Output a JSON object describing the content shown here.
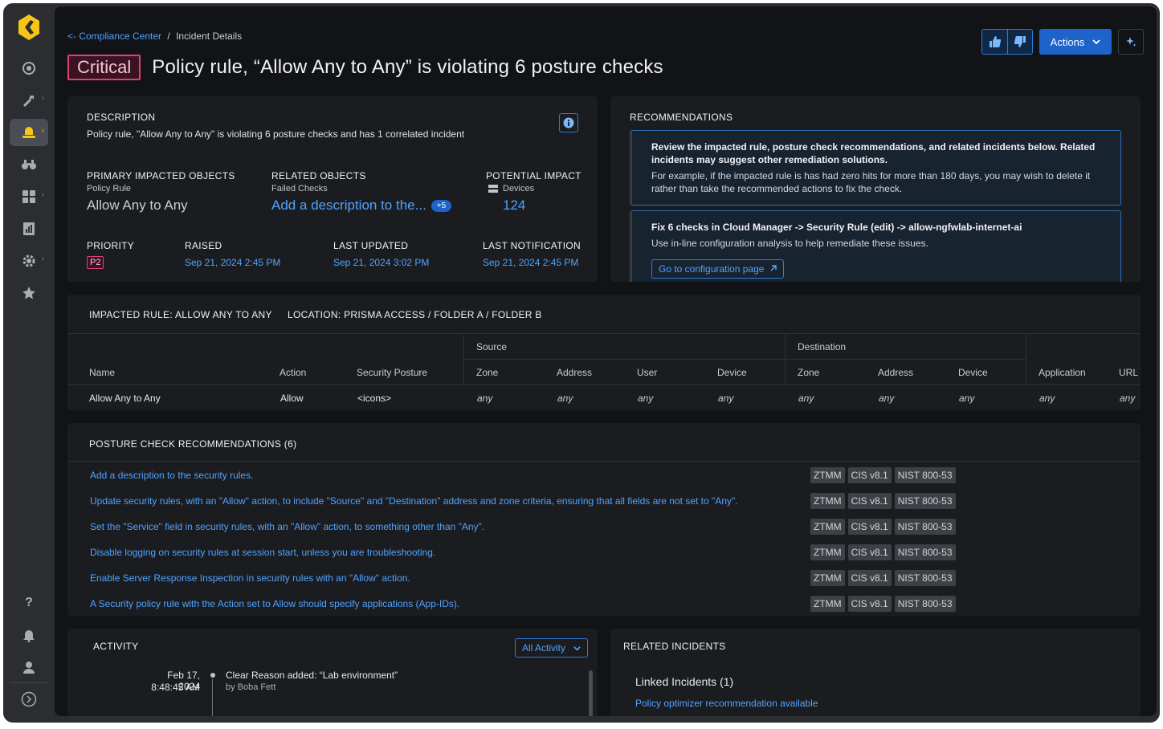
{
  "rail": {
    "items": [
      {
        "icon": "radar-icon"
      },
      {
        "icon": "build-icon"
      },
      {
        "icon": "alert-icon"
      },
      {
        "icon": "binoculars-icon"
      },
      {
        "icon": "apps-icon"
      },
      {
        "icon": "report-icon"
      },
      {
        "icon": "settings-icon"
      },
      {
        "icon": "star-icon"
      }
    ],
    "bottom": [
      "help-icon",
      "bell-icon",
      "user-icon",
      "expand-icon"
    ]
  },
  "breadcrumb": {
    "back": "<- Compliance Center",
    "sep": "/",
    "current": "Incident Details"
  },
  "header": {
    "severity": "Critical",
    "title": "Policy rule, “Allow Any to Any” is violating 6 posture checks",
    "actions_label": "Actions"
  },
  "summary": {
    "description_label": "DESCRIPTION",
    "description": "Policy rule, \"Allow Any to Any\" is violating 6 posture checks and has 1 correlated incident",
    "primary_label": "PRIMARY IMPACTED OBJECTS",
    "primary_sub": "Policy Rule",
    "primary_value": "Allow Any to Any",
    "related_label": "RELATED OBJECTS",
    "related_sub": "Failed Checks",
    "related_value": "Add a description to the...",
    "related_more": "+5",
    "impact_label": "POTENTIAL IMPACT",
    "impact_sub": "Devices",
    "impact_value": "124",
    "priority_label": "PRIORITY",
    "priority_value": "P2",
    "raised_label": "RAISED",
    "raised_value": "Sep 21, 2024 2:45 PM",
    "updated_label": "LAST UPDATED",
    "updated_value": "Sep 21, 2024 3:02 PM",
    "notification_label": "LAST NOTIFICATION",
    "notification_value": "Sep 21, 2024 2:45 PM"
  },
  "recommendations": {
    "label": "RECOMMENDATIONS",
    "box1_title": "Review the impacted rule, posture check recommendations, and related incidents below. Related incidents may suggest other remediation solutions.",
    "box1_text": "For example, if the impacted rule is has had zero hits for more than 180 days, you may wish to delete it rather than take the recommended actions to fix the check.",
    "box2_title": "Fix 6 checks in Cloud Manager -> Security Rule (edit) -> allow-ngfwlab-internet-ai",
    "box2_text": "Use in-line configuration analysis to help remediate these issues.",
    "box2_button": "Go to configuration page"
  },
  "rule": {
    "impacted_label": "IMPACTED RULE: ALLOW ANY TO ANY",
    "location_label": "LOCATION: PRISMA ACCESS / FOLDER A / FOLDER B",
    "group_source": "Source",
    "group_destination": "Destination",
    "headers": [
      "Name",
      "Action",
      "Security Posture",
      "Zone",
      "Address",
      "User",
      "Device",
      "Zone",
      "Address",
      "Device",
      "Application",
      "URL C"
    ],
    "row": [
      "Allow Any to Any",
      "Allow",
      "<icons>",
      "any",
      "any",
      "any",
      "any",
      "any",
      "any",
      "any",
      "any",
      "any"
    ]
  },
  "posture": {
    "label": "POSTURE CHECK RECOMMENDATIONS (6)",
    "items": [
      "Add a description to the security rules.",
      "Update security rules, with an \"Allow\" action, to include \"Source\" and \"Destination\" address and zone criteria, ensuring that all fields are not set to \"Any\".",
      "Set the \"Service\" field in security rules, with an \"Allow\" action, to something other than \"Any\".",
      "Disable logging on security rules at session start, unless you are troubleshooting.",
      "Enable Server Response Inspection in security rules with an \"Allow\" action.",
      "A Security policy rule with the Action set to Allow should specify applications (App-IDs)."
    ],
    "tags": [
      "ZTMM",
      "CIS v8.1",
      "NIST 800-53"
    ]
  },
  "activity": {
    "label": "ACTIVITY",
    "filter": "All Activity",
    "entry_date": "Feb 17, 2024",
    "entry_time": "8:48:45 AM",
    "entry_text": "Clear Reason added: “Lab environment”",
    "entry_by": "by Boba Fett"
  },
  "related": {
    "label": "RELATED INCIDENTS",
    "linked": "Linked Incidents (1)",
    "item": "Policy optimizer recommendation available"
  },
  "colors": {
    "accent": "#4fa3ff",
    "critical": "#e0407a",
    "primary_button": "#1d63c9",
    "active_rail": "#f5c518"
  }
}
